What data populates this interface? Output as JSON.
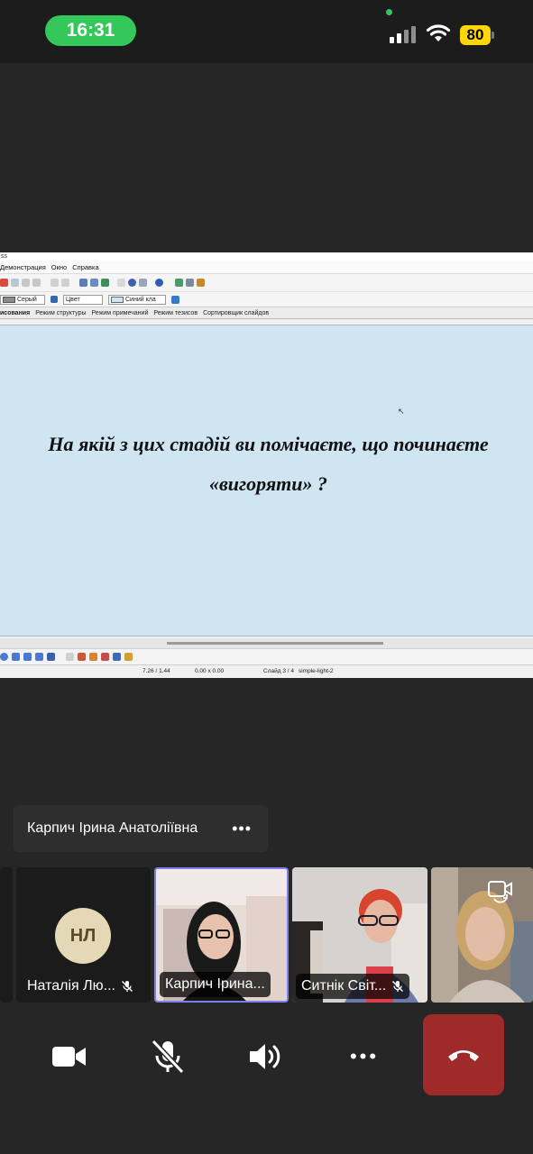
{
  "status_bar": {
    "time": "16:31",
    "battery": "80"
  },
  "shared_screen": {
    "title_fragment": "ss",
    "menu": [
      "Демонстрация",
      "Окно",
      "Справка"
    ],
    "toolbar2": {
      "line_color": "Серый",
      "fill_type": "Цвет",
      "fill_color": "Синий кла"
    },
    "tabs": [
      "исования",
      "Режим структуры",
      "Режим примечаний",
      "Режим тезисов",
      "Сортировщик слайдов"
    ],
    "slide_text": "На якій з цих стадій ви помічаєте, що починаєте «вигоряти» ?",
    "status": {
      "position": "7.26 / 1.44",
      "size": "0.00 x 0.00",
      "slide": "Слайд 3 / 4",
      "theme": "simple-light-2"
    }
  },
  "active_speaker": {
    "name": "Карпич Ірина Анатоліївна",
    "more": "•••"
  },
  "participants": [
    {
      "initials": "НЛ",
      "label": "Наталія Лю..."
    },
    {
      "label": "Карпич Ірина..."
    },
    {
      "label": "Ситнік Світ..."
    },
    {
      "label": ""
    }
  ],
  "controls": {
    "more": "•••"
  },
  "colors": {
    "time_pill": "#34c759",
    "battery": "#ffd60a",
    "slide_bg": "#cfe5f2",
    "active_tile_border": "#7d7ff0",
    "end_call": "#9e2a2a"
  }
}
